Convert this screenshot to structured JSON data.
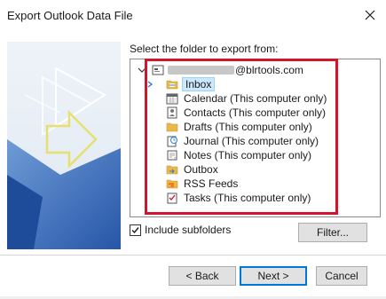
{
  "window": {
    "title": "Export Outlook Data File",
    "close_icon": "close-icon"
  },
  "main": {
    "prompt": "Select the folder to export from:",
    "account": {
      "name_visible": "@blrtools.com",
      "expanded": true
    },
    "folders": [
      {
        "label": "Inbox",
        "icon": "inbox-folder-icon",
        "selected": true,
        "has_children": true
      },
      {
        "label": "Calendar (This computer only)",
        "icon": "calendar-icon"
      },
      {
        "label": "Contacts (This computer only)",
        "icon": "contacts-icon"
      },
      {
        "label": "Drafts (This computer only)",
        "icon": "drafts-folder-icon"
      },
      {
        "label": "Journal (This computer only)",
        "icon": "journal-icon"
      },
      {
        "label": "Notes (This computer only)",
        "icon": "notes-icon"
      },
      {
        "label": "Outbox",
        "icon": "outbox-icon"
      },
      {
        "label": "RSS Feeds",
        "icon": "rss-feed-icon"
      },
      {
        "label": "Tasks (This computer only)",
        "icon": "tasks-icon"
      }
    ],
    "include_subfolders": {
      "label": "Include subfolders",
      "checked": true
    },
    "filter_label": "Filter..."
  },
  "footer": {
    "back_label": "< Back",
    "next_label": "Next >",
    "cancel_label": "Cancel"
  },
  "colors": {
    "highlight_box": "#d3142d",
    "selection_bg": "#cce8ff",
    "default_button_border": "#0078d7",
    "folder_yellow": "#e9b84a"
  }
}
